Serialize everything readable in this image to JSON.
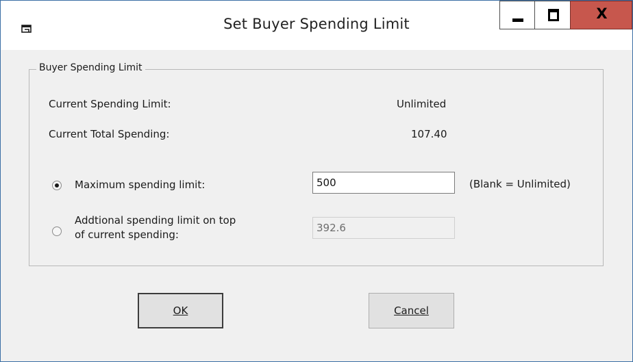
{
  "window": {
    "title": "Set Buyer Spending Limit"
  },
  "titlebar": {
    "minimize_glyph": "minimize",
    "maximize_glyph": "maximize",
    "close_label": "X"
  },
  "group": {
    "legend": "Buyer Spending Limit"
  },
  "info": {
    "current_limit_label": "Current Spending Limit:",
    "current_limit_value": "Unlimited",
    "current_total_label": "Current Total Spending:",
    "current_total_value": "107.40"
  },
  "options": {
    "max_label": "Maximum spending limit:",
    "max_value": "500",
    "max_hint": "(Blank = Unlimited)",
    "max_checked": true,
    "additional_label_line1": "Addtional spending limit on top",
    "additional_label_line2": "of current spending:",
    "additional_value": "392.6",
    "additional_checked": false
  },
  "buttons": {
    "ok_label": "OK",
    "cancel_label": "Cancel"
  },
  "colors": {
    "close_button": "#c7574d",
    "window_bg": "#f0f0f0",
    "frame": "#3a6ea5"
  },
  "icons": {
    "app": "window-app-icon"
  }
}
